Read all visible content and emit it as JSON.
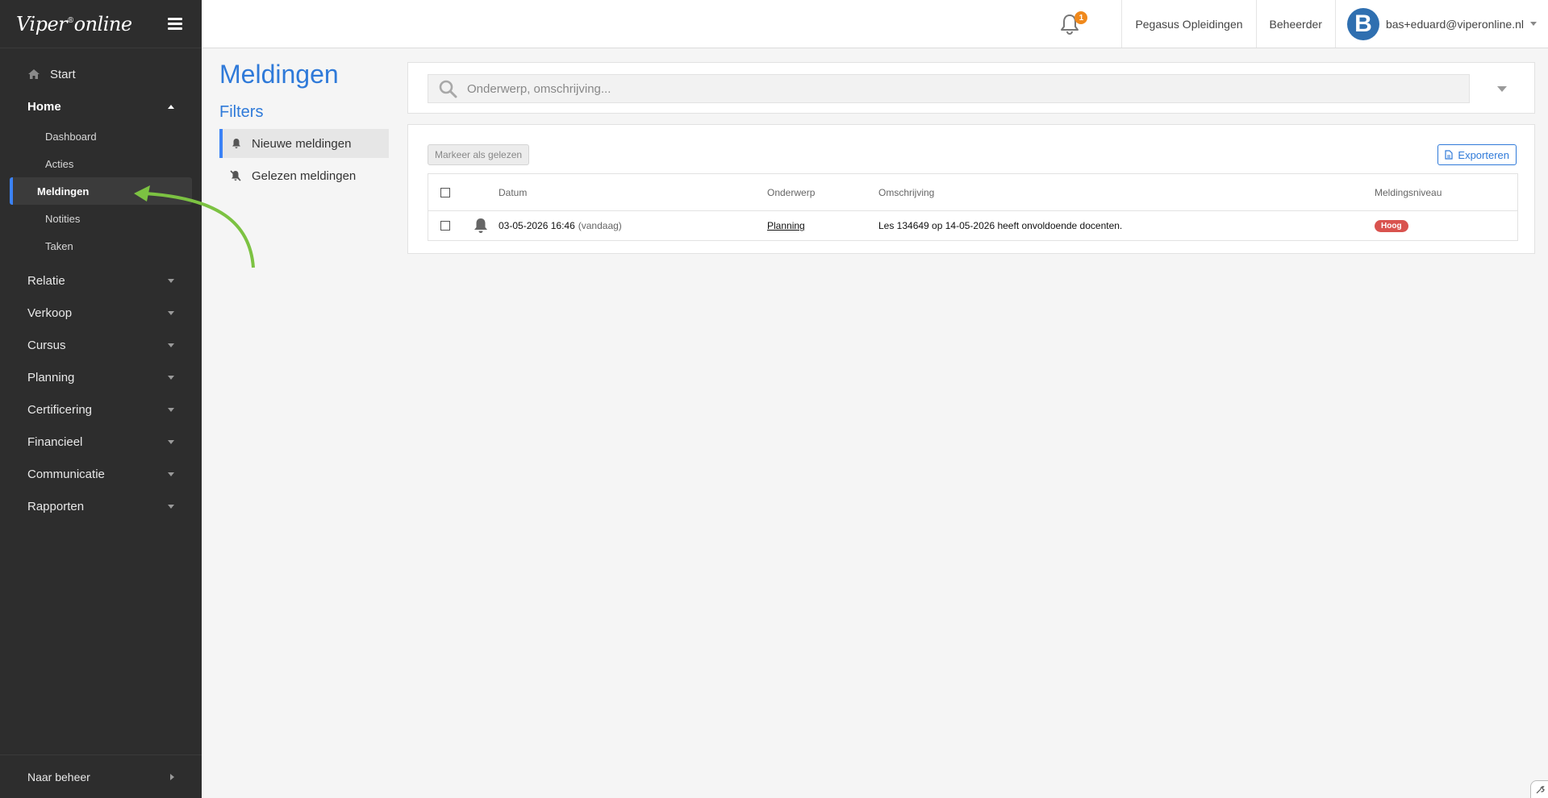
{
  "brand": {
    "logo": "Viper",
    "logo_mark": "®",
    "logo_suffix": "online"
  },
  "sidebar": {
    "start": "Start",
    "home": "Home",
    "home_sub": [
      "Dashboard",
      "Acties",
      "Meldingen",
      "Notities",
      "Taken"
    ],
    "active_sub": "Meldingen",
    "groups": [
      "Relatie",
      "Verkoop",
      "Cursus",
      "Planning",
      "Certificering",
      "Financieel",
      "Communicatie",
      "Rapporten"
    ],
    "bottom": "Naar beheer"
  },
  "topbar": {
    "notification_count": "1",
    "org": "Pegasus Opleidingen",
    "role": "Beheerder",
    "avatar_letter": "B",
    "email": "bas+eduard@viperonline.nl"
  },
  "main": {
    "title": "Meldingen",
    "filters_title": "Filters",
    "filters": [
      "Nieuwe meldingen",
      "Gelezen meldingen"
    ],
    "search_placeholder": "Onderwerp, omschrijving...",
    "mark_read_button": "Markeer als gelezen",
    "export_button": "Exporteren",
    "columns": [
      "Datum",
      "Onderwerp",
      "Omschrijving",
      "Meldingsniveau"
    ],
    "rows": [
      {
        "date": "03-05-2026 16:46",
        "date_note": "(vandaag)",
        "subject": "Planning",
        "description": "Les 134649 op 14-05-2026 heeft onvoldoende docenten.",
        "level": "Hoog"
      }
    ]
  },
  "colors": {
    "accent": "#2f7ad9",
    "sidebar_bg": "#2d2d2d",
    "badge": "#f0891c",
    "level_high": "#d9534f",
    "annotation_arrow": "#7cc242"
  }
}
